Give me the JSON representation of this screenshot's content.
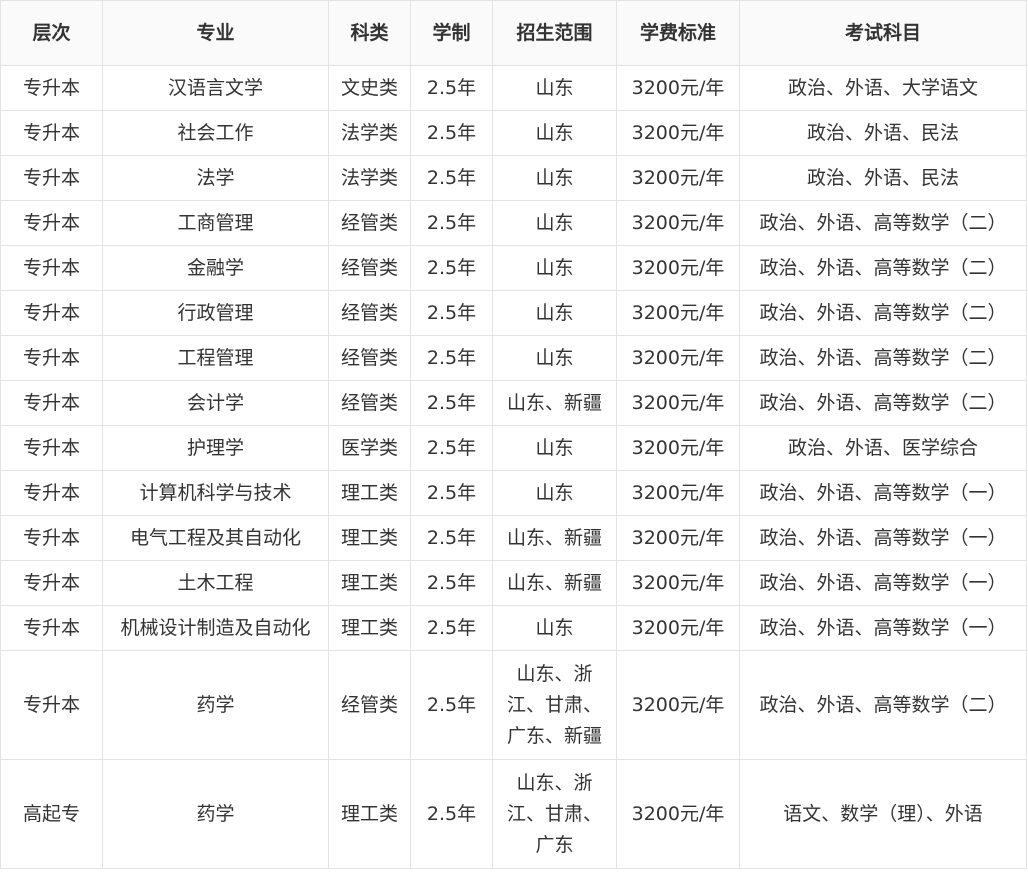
{
  "table": {
    "headers": [
      "层次",
      "专业",
      "科类",
      "学制",
      "招生范围",
      "学费标准",
      "考试科目"
    ],
    "rows": [
      [
        "专升本",
        "汉语言文学",
        "文史类",
        "2.5年",
        "山东",
        "3200元/年",
        "政治、外语、大学语文"
      ],
      [
        "专升本",
        "社会工作",
        "法学类",
        "2.5年",
        "山东",
        "3200元/年",
        "政治、外语、民法"
      ],
      [
        "专升本",
        "法学",
        "法学类",
        "2.5年",
        "山东",
        "3200元/年",
        "政治、外语、民法"
      ],
      [
        "专升本",
        "工商管理",
        "经管类",
        "2.5年",
        "山东",
        "3200元/年",
        "政治、外语、高等数学（二）"
      ],
      [
        "专升本",
        "金融学",
        "经管类",
        "2.5年",
        "山东",
        "3200元/年",
        "政治、外语、高等数学（二）"
      ],
      [
        "专升本",
        "行政管理",
        "经管类",
        "2.5年",
        "山东",
        "3200元/年",
        "政治、外语、高等数学（二）"
      ],
      [
        "专升本",
        "工程管理",
        "经管类",
        "2.5年",
        "山东",
        "3200元/年",
        "政治、外语、高等数学（二）"
      ],
      [
        "专升本",
        "会计学",
        "经管类",
        "2.5年",
        "山东、新疆",
        "3200元/年",
        "政治、外语、高等数学（二）"
      ],
      [
        "专升本",
        "护理学",
        "医学类",
        "2.5年",
        "山东",
        "3200元/年",
        "政治、外语、医学综合"
      ],
      [
        "专升本",
        "计算机科学与技术",
        "理工类",
        "2.5年",
        "山东",
        "3200元/年",
        "政治、外语、高等数学（一）"
      ],
      [
        "专升本",
        "电气工程及其自动化",
        "理工类",
        "2.5年",
        "山东、新疆",
        "3200元/年",
        "政治、外语、高等数学（一）"
      ],
      [
        "专升本",
        "土木工程",
        "理工类",
        "2.5年",
        "山东、新疆",
        "3200元/年",
        "政治、外语、高等数学（一）"
      ],
      [
        "专升本",
        "机械设计制造及自动化",
        "理工类",
        "2.5年",
        "山东",
        "3200元/年",
        "政治、外语、高等数学（一）"
      ],
      [
        "专升本",
        "药学",
        "经管类",
        "2.5年",
        "山东、浙江、甘肃、广东、新疆",
        "3200元/年",
        "政治、外语、高等数学（二）"
      ],
      [
        "高起专",
        "药学",
        "理工类",
        "2.5年",
        "山东、浙江、甘肃、广东",
        "3200元/年",
        "语文、数学（理）、外语"
      ]
    ]
  }
}
